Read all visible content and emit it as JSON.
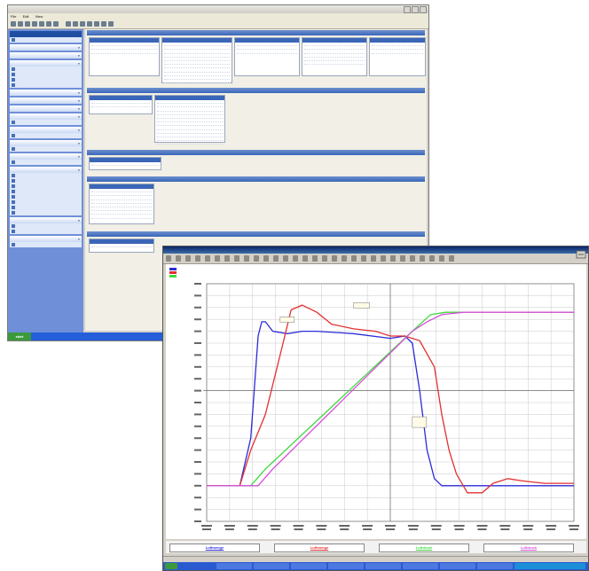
{
  "back_window": {
    "title": "",
    "menu": [
      "File",
      "Edit",
      "View"
    ],
    "sidebar_groups": [
      {
        "label": "",
        "active": true,
        "items": [
          ""
        ]
      },
      {
        "label": "",
        "items": []
      },
      {
        "label": "",
        "items": []
      },
      {
        "label": "",
        "items": [
          "",
          "",
          "",
          ""
        ]
      },
      {
        "label": "",
        "items": []
      },
      {
        "label": "",
        "items": []
      },
      {
        "label": "",
        "items": []
      },
      {
        "label": "",
        "items": [
          ""
        ]
      },
      {
        "label": "",
        "items": [
          ""
        ]
      },
      {
        "label": "",
        "items": [
          ""
        ]
      },
      {
        "label": "",
        "items": [
          ""
        ]
      },
      {
        "label": "",
        "items": [
          "",
          "",
          "",
          "",
          "",
          "",
          "",
          ""
        ]
      },
      {
        "label": "",
        "items": [
          "",
          ""
        ]
      },
      {
        "label": "",
        "items": [
          ""
        ]
      }
    ],
    "start_label": "start"
  },
  "front_window": {
    "title": "",
    "chart_title": "",
    "status": "",
    "footer_series": [
      "Luftmenge",
      "Luftmenge",
      "Luftdruck",
      "Luftdruck"
    ],
    "annotations": [
      "",
      "",
      ""
    ]
  },
  "colors": {
    "sidebar": "#6f90d8",
    "section_header": "#3a66b8",
    "blue_series": "#2b2bd9",
    "red_series": "#e23030",
    "green_series": "#3fd93f",
    "magenta_series": "#d94fd9",
    "grid": "#c8c8c8"
  },
  "chart_data": {
    "type": "line",
    "xlabel": "",
    "ylabel": "",
    "xlim": [
      0,
      100
    ],
    "ylim": [
      0,
      100
    ],
    "grid": true,
    "legend_placement": "top-left",
    "series": [
      {
        "color": "#2b2bd9",
        "points": [
          [
            0,
            15
          ],
          [
            9,
            15
          ],
          [
            12,
            35
          ],
          [
            14,
            78
          ],
          [
            15,
            84
          ],
          [
            16,
            84
          ],
          [
            18,
            80
          ],
          [
            22,
            79
          ],
          [
            26,
            80
          ],
          [
            30,
            80
          ],
          [
            40,
            79
          ],
          [
            50,
            77
          ],
          [
            54,
            78
          ],
          [
            56,
            75
          ],
          [
            58,
            55
          ],
          [
            60,
            30
          ],
          [
            62,
            18
          ],
          [
            64,
            15
          ],
          [
            70,
            15
          ],
          [
            80,
            15
          ],
          [
            90,
            15
          ],
          [
            100,
            15
          ]
        ]
      },
      {
        "color": "#e23030",
        "points": [
          [
            0,
            15
          ],
          [
            9,
            15
          ],
          [
            12,
            30
          ],
          [
            16,
            45
          ],
          [
            20,
            70
          ],
          [
            23,
            89
          ],
          [
            26,
            91
          ],
          [
            30,
            88
          ],
          [
            34,
            83
          ],
          [
            40,
            81
          ],
          [
            46,
            80
          ],
          [
            50,
            78
          ],
          [
            54,
            78
          ],
          [
            58,
            76
          ],
          [
            62,
            65
          ],
          [
            64,
            45
          ],
          [
            66,
            30
          ],
          [
            68,
            20
          ],
          [
            71,
            12
          ],
          [
            75,
            12
          ],
          [
            78,
            16
          ],
          [
            82,
            18
          ],
          [
            86,
            17
          ],
          [
            92,
            16
          ],
          [
            100,
            16
          ]
        ]
      },
      {
        "color": "#3fd93f",
        "points": [
          [
            0,
            15
          ],
          [
            12,
            15
          ],
          [
            16,
            22
          ],
          [
            56,
            80
          ],
          [
            61,
            87
          ],
          [
            65,
            88
          ],
          [
            70,
            88
          ],
          [
            80,
            88
          ],
          [
            90,
            88
          ],
          [
            100,
            88
          ]
        ]
      },
      {
        "color": "#d94fd9",
        "points": [
          [
            0,
            15
          ],
          [
            14,
            15
          ],
          [
            18,
            22
          ],
          [
            56,
            80
          ],
          [
            60,
            84
          ],
          [
            64,
            87
          ],
          [
            70,
            88
          ],
          [
            80,
            88
          ],
          [
            90,
            88
          ],
          [
            100,
            88
          ]
        ]
      }
    ]
  }
}
